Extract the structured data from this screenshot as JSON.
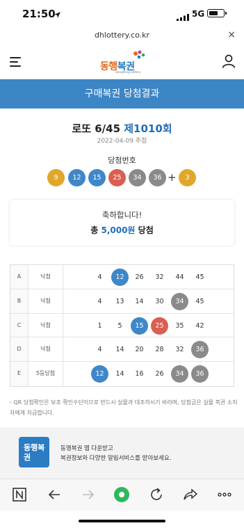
{
  "status": {
    "time": "21:50",
    "network": "5G",
    "battery_level": 0.62
  },
  "browser": {
    "url": "dhlottery.co.kr",
    "close_icon": "close-icon"
  },
  "header": {
    "logo_text_1": "동행",
    "logo_text_2": "복권",
    "logo_sub": "Donghang Lottery"
  },
  "banner": {
    "title": "구매복권 당첨결과"
  },
  "draw": {
    "game": "로또 6/45",
    "round": "제1010회",
    "date": "2022-04-09 추첨",
    "winning_label": "당첨번호",
    "numbers": [
      {
        "value": "9",
        "color": "#e0a72a"
      },
      {
        "value": "12",
        "color": "#3f87c9"
      },
      {
        "value": "15",
        "color": "#3f87c9"
      },
      {
        "value": "25",
        "color": "#db5e52"
      },
      {
        "value": "34",
        "color": "#8a8a8a"
      },
      {
        "value": "36",
        "color": "#8a8a8a"
      }
    ],
    "plus": "+",
    "bonus": {
      "value": "3",
      "color": "#e0a72a"
    }
  },
  "congrats": {
    "line1": "축하합니다!",
    "prefix": "총",
    "amount": "5,000원",
    "suffix": "당첨"
  },
  "results": [
    {
      "label": "A",
      "result": "낙첨",
      "numbers": [
        "4",
        "12",
        "26",
        "32",
        "44",
        "45"
      ],
      "matched": [
        1
      ]
    },
    {
      "label": "B",
      "result": "낙첨",
      "numbers": [
        "4",
        "13",
        "14",
        "30",
        "34",
        "45"
      ],
      "matched": [
        4
      ]
    },
    {
      "label": "C",
      "result": "낙첨",
      "numbers": [
        "1",
        "5",
        "15",
        "25",
        "35",
        "42"
      ],
      "matched": [
        2,
        3
      ]
    },
    {
      "label": "D",
      "result": "낙첨",
      "numbers": [
        "4",
        "14",
        "20",
        "28",
        "32",
        "36"
      ],
      "matched": [
        5
      ]
    },
    {
      "label": "E",
      "result": "5등당첨",
      "numbers": [
        "12",
        "14",
        "16",
        "26",
        "34",
        "36"
      ],
      "matched": [
        0,
        4,
        5
      ]
    }
  ],
  "note": "- QR 당첨확인은 보조 확인수단이므로 반드시 실물과 대조하시기 바라며, 당첨금은 실물 복권 소지자에게 지급합니다.",
  "promo": {
    "icon_text": "동행복권",
    "line1": "동행복권 앱 다운받고",
    "line2": "복권정보와 다양한 알림서비스를 받아보세요."
  },
  "toolbar": {
    "icons": [
      "naver-icon",
      "back-icon",
      "forward-icon",
      "home-icon",
      "refresh-icon",
      "share-icon",
      "more-icon"
    ]
  }
}
